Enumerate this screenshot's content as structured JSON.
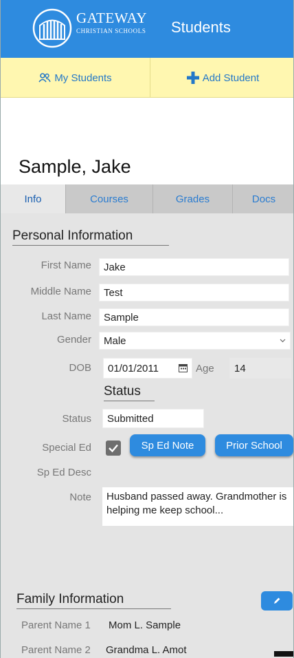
{
  "header": {
    "logo_title": "GATEWAY",
    "logo_subtitle": "CHRISTIAN SCHOOLS",
    "title": "Students"
  },
  "nav": {
    "my_students": "My Students",
    "add_student": "Add Student"
  },
  "student": {
    "name": "Sample, Jake"
  },
  "tabs": [
    {
      "label": "Info",
      "active": true
    },
    {
      "label": "Courses"
    },
    {
      "label": "Grades"
    },
    {
      "label": "Docs"
    }
  ],
  "personal": {
    "title": "Personal Information",
    "first_name": {
      "label": "First Name",
      "value": "Jake"
    },
    "middle_name": {
      "label": "Middle Name",
      "value": "Test"
    },
    "last_name": {
      "label": "Last Name",
      "value": "Sample"
    },
    "gender": {
      "label": "Gender",
      "value": "Male"
    },
    "dob": {
      "label": "DOB",
      "value": "01/01/2011"
    },
    "age": {
      "label": "Age",
      "value": "14"
    }
  },
  "status": {
    "title": "Status",
    "status": {
      "label": "Status",
      "value": "Submitted"
    },
    "special_ed": {
      "label": "Special Ed",
      "checked": true
    },
    "sp_ed_note_button": "Sp Ed Note",
    "prior_school_button": "Prior School",
    "sp_ed_desc": {
      "label": "Sp Ed Desc",
      "value": ""
    },
    "note": {
      "label": "Note",
      "value": "Husband passed away. Grandmother is helping me keep school..."
    }
  },
  "family": {
    "title": "Family Information",
    "parent1": {
      "label": "Parent Name 1",
      "value": "Mom L. Sample"
    },
    "parent2": {
      "label": "Parent Name 2",
      "value": "Grandma L. Amot"
    }
  },
  "colors": {
    "header_blue": "#2e8bdf",
    "nav_yellow": "#fff7b0",
    "link_blue": "#2478c8",
    "content_gray": "#e4e4e4"
  }
}
